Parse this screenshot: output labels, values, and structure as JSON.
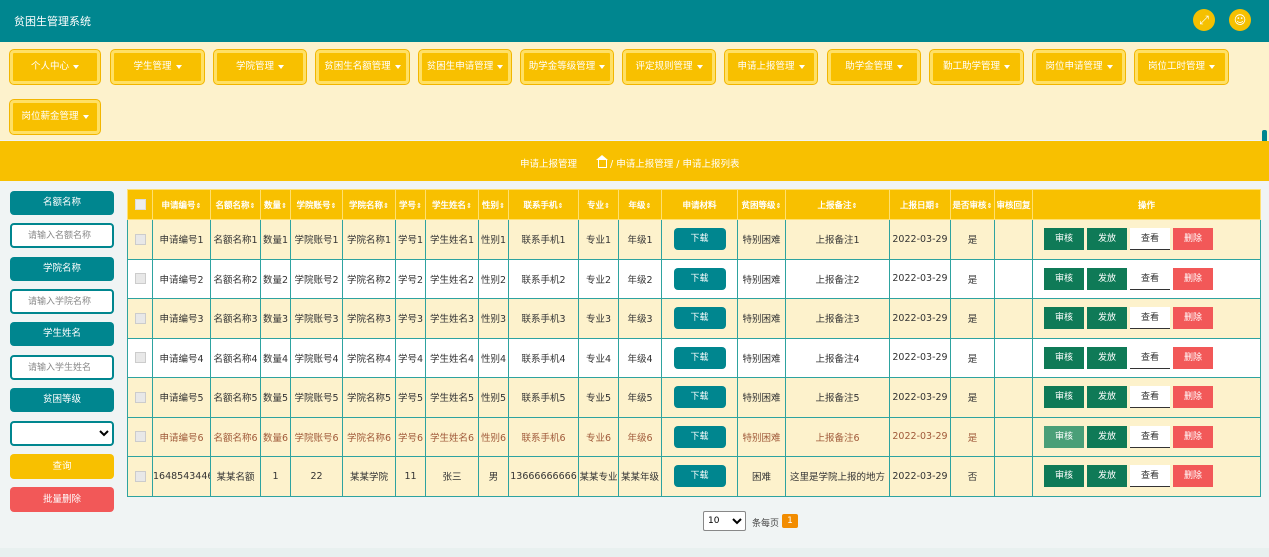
{
  "app": {
    "title": "贫困生管理系统"
  },
  "topbar": {
    "fullscreen_icon": "expand-icon",
    "user_icon": "user-icon"
  },
  "nav": {
    "items": [
      {
        "label": "个人中心"
      },
      {
        "label": "学生管理"
      },
      {
        "label": "学院管理"
      },
      {
        "label": "贫困生名额管理"
      },
      {
        "label": "贫困生申请管理"
      },
      {
        "label": "助学金等级管理"
      },
      {
        "label": "评定规则管理"
      },
      {
        "label": "申请上报管理"
      },
      {
        "label": "助学金管理"
      },
      {
        "label": "勤工助学管理"
      },
      {
        "label": "岗位申请管理"
      },
      {
        "label": "岗位工时管理"
      },
      {
        "label": "岗位薪金管理"
      }
    ]
  },
  "breadcrumb": {
    "title": "申请上报管理",
    "path": "/ 申请上报管理 / 申请上报列表"
  },
  "search": {
    "quota_label": "名额名称",
    "quota_placeholder": "请输入名额名称",
    "college_label": "学院名称",
    "college_placeholder": "请输入学院名称",
    "student_label": "学生姓名",
    "student_placeholder": "请输入学生姓名",
    "level_label": "贫困等级",
    "level_value": "",
    "query_label": "查询",
    "batch_delete_label": "批量删除"
  },
  "table": {
    "headers": [
      "申请编号",
      "名额名称",
      "数量",
      "学院账号",
      "学院名称",
      "学号",
      "学生姓名",
      "性别",
      "联系手机",
      "专业",
      "年级",
      "申请材料",
      "贫困等级",
      "上报备注",
      "上报日期",
      "是否审核",
      "审核回复",
      "操作"
    ],
    "sort_mark": "⇕",
    "download_label": "下载",
    "actions": {
      "audit": "审核",
      "issue": "发放",
      "view": "查看",
      "delete": "删除"
    },
    "rows": [
      {
        "cells": [
          "申请编号1",
          "名额名称1",
          "数量1",
          "学院账号1",
          "学院名称1",
          "学号1",
          "学生姓名1",
          "性别1",
          "联系手机1",
          "专业1",
          "年级1",
          "特别困难",
          "上报备注1",
          "2022-03-29",
          "是",
          ""
        ]
      },
      {
        "cells": [
          "申请编号2",
          "名额名称2",
          "数量2",
          "学院账号2",
          "学院名称2",
          "学号2",
          "学生姓名2",
          "性别2",
          "联系手机2",
          "专业2",
          "年级2",
          "特别困难",
          "上报备注2",
          "2022-03-29",
          "是",
          ""
        ]
      },
      {
        "cells": [
          "申请编号3",
          "名额名称3",
          "数量3",
          "学院账号3",
          "学院名称3",
          "学号3",
          "学生姓名3",
          "性别3",
          "联系手机3",
          "专业3",
          "年级3",
          "特别困难",
          "上报备注3",
          "2022-03-29",
          "是",
          ""
        ]
      },
      {
        "cells": [
          "申请编号4",
          "名额名称4",
          "数量4",
          "学院账号4",
          "学院名称4",
          "学号4",
          "学生姓名4",
          "性别4",
          "联系手机4",
          "专业4",
          "年级4",
          "特别困难",
          "上报备注4",
          "2022-03-29",
          "是",
          ""
        ]
      },
      {
        "cells": [
          "申请编号5",
          "名额名称5",
          "数量5",
          "学院账号5",
          "学院名称5",
          "学号5",
          "学生姓名5",
          "性别5",
          "联系手机5",
          "专业5",
          "年级5",
          "特别困难",
          "上报备注5",
          "2022-03-29",
          "是",
          ""
        ]
      },
      {
        "cells": [
          "申请编号6",
          "名额名称6",
          "数量6",
          "学院账号6",
          "学院名称6",
          "学号6",
          "学生姓名6",
          "性别6",
          "联系手机6",
          "专业6",
          "年级6",
          "特别困难",
          "上报备注6",
          "2022-03-29",
          "是",
          ""
        ]
      },
      {
        "cells": [
          "1648543446",
          "某某名额",
          "1",
          "22",
          "某某学院",
          "11",
          "张三",
          "男",
          "13666666666",
          "某某专业",
          "某某年级",
          "困难",
          "这里是学院上报的地方",
          "2022-03-29",
          "否",
          ""
        ]
      }
    ]
  },
  "pager": {
    "page_size": "10",
    "per_page_label": "条每页",
    "current_page": "1"
  }
}
